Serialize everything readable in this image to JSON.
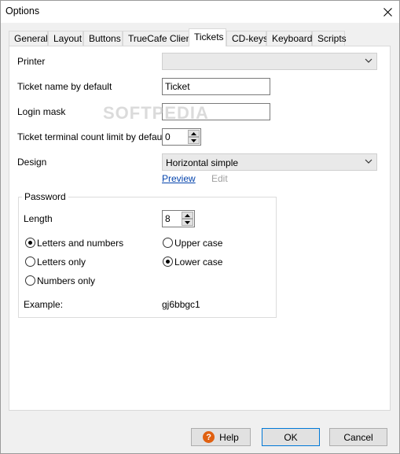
{
  "window": {
    "title": "Options"
  },
  "tabs": [
    {
      "label": "General"
    },
    {
      "label": "Layout"
    },
    {
      "label": "Buttons"
    },
    {
      "label": "TrueCafe Client"
    },
    {
      "label": "Tickets"
    },
    {
      "label": "CD-keys"
    },
    {
      "label": "Keyboard"
    },
    {
      "label": "Scripts"
    }
  ],
  "active_tab": "Tickets",
  "form": {
    "printer_label": "Printer",
    "printer_value": "",
    "ticket_name_label": "Ticket name by default",
    "ticket_name_value": "Ticket",
    "login_mask_label": "Login mask",
    "login_mask_value": "",
    "count_limit_label": "Ticket terminal count limit by default",
    "count_limit_value": "0",
    "design_label": "Design",
    "design_value": "Horizontal simple",
    "preview_link": "Preview",
    "edit_link": "Edit"
  },
  "password": {
    "group_label": "Password",
    "length_label": "Length",
    "length_value": "8",
    "options": {
      "letters_numbers": "Letters and numbers",
      "letters_only": "Letters only",
      "numbers_only": "Numbers only",
      "upper_case": "Upper case",
      "lower_case": "Lower case"
    },
    "selected_charset": "Letters and numbers",
    "selected_case": "Lower case",
    "example_label": "Example:",
    "example_value": "gj6bbgc1"
  },
  "watermark": "SOFTPEDIA",
  "buttons": {
    "help": "Help",
    "ok": "OK",
    "cancel": "Cancel"
  },
  "icons": {
    "close": "close-icon",
    "dropdown": "chevron-down-icon",
    "help": "help-icon"
  }
}
